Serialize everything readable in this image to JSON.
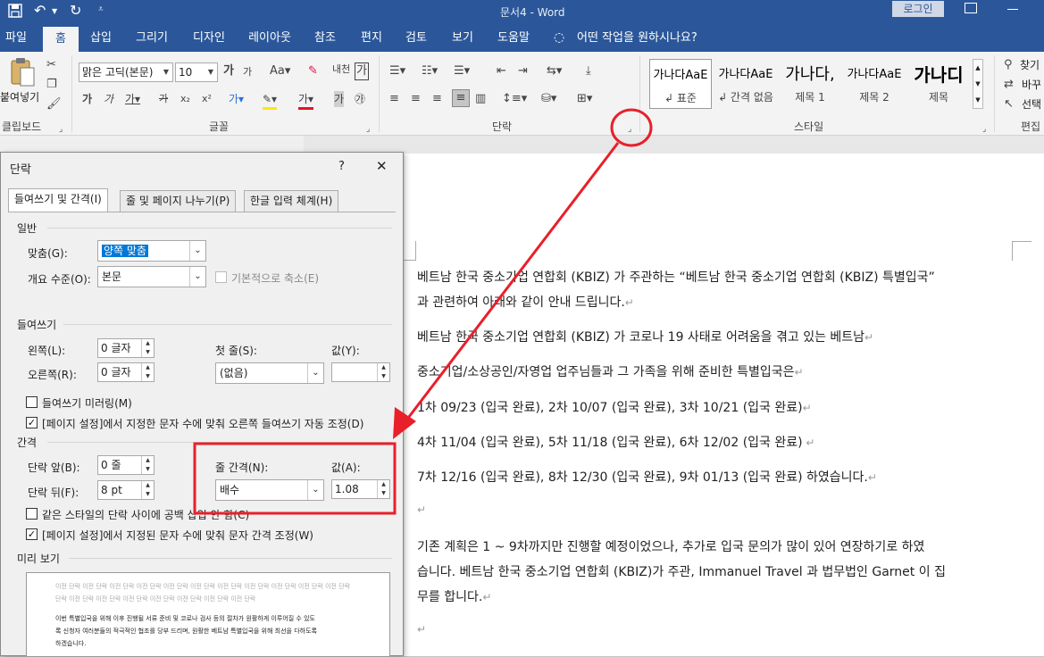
{
  "titlebar": {
    "title": "문서4 - Word",
    "login": "로그인"
  },
  "tabs": [
    "파일",
    "홈",
    "삽입",
    "그리기",
    "디자인",
    "레이아웃",
    "참조",
    "편지",
    "검토",
    "보기",
    "도움말"
  ],
  "tellme": "어떤 작업을 원하시나요?",
  "ribbon": {
    "paste": "붙여넣기",
    "clipboard": "클립보드",
    "font_group": "글꼴",
    "paragraph_group": "단락",
    "styles_group": "스타일",
    "edit_group": "편집",
    "font_name": "맑은 고딕(본문)",
    "font_size": "10",
    "styles": [
      {
        "sample": "가나다AaE",
        "name": "↲ 표준"
      },
      {
        "sample": "가나다AaE",
        "name": "↲ 간격 없음"
      },
      {
        "sample": "가나다,",
        "name": "제목 1"
      },
      {
        "sample": "가나다AaE",
        "name": "제목 2"
      },
      {
        "sample": "가나디",
        "name": "제목"
      }
    ],
    "find": "찾기",
    "replace": "바꾸",
    "select": "선택"
  },
  "dialog": {
    "title": "단락",
    "help": "?",
    "close": "✕",
    "tabs": [
      "들여쓰기 및 간격(I)",
      "줄 및 페이지 나누기(P)",
      "한글 입력 체계(H)"
    ],
    "general": "일반",
    "alignment_label": "맞춤(G):",
    "alignment_value": "양쪽 맞춤",
    "outline_label": "개요 수준(O):",
    "outline_value": "본문",
    "collapsed_label": "기본적으로 축소(E)",
    "indent": "들여쓰기",
    "left_label": "왼쪽(L):",
    "left_value": "0 글자",
    "right_label": "오른쪽(R):",
    "right_value": "0 글자",
    "first_line_label": "첫 줄(S):",
    "first_line_value": "(없음)",
    "by_label": "값(Y):",
    "by_value": "",
    "mirror_label": "들여쓰기 미러링(M)",
    "auto_indent_label": "[페이지 설정]에서 지정한 문자 수에 맞춰 오른쪽 들여쓰기 자동 조정(D)",
    "spacing": "간격",
    "before_label": "단락 앞(B):",
    "before_value": "0 줄",
    "after_label": "단락 뒤(F):",
    "after_value": "8 pt",
    "line_spacing_label": "줄 간격(N):",
    "line_spacing_value": "배수",
    "at_label": "값(A):",
    "at_value": "1.08",
    "no_space_label": "같은 스타일의 단락 사이에 공백 삽입 안 함(C)",
    "grid_label": "[페이지 설정]에서 지정된 문자 수에 맞춰 문자 간격 조정(W)",
    "preview": "미리 보기",
    "preview_prev1": "이전 단락 이전 단락 이전 단락 이전 단락 이전 단락 이전 단락 이전 단락 이전 단락 이전 단락 이전 단락 이전 단락",
    "preview_prev2": "단락 이전 단락 이전 단락 이전 단락 이전 단락 이전 단락 이전 단락 이전 단락",
    "preview_cur1": "이번 특별입국을 위해 이후 진행될 서류 준비 및 코로나 검사 등의 절차가 원활하게 이루어질 수 있도",
    "preview_cur2": "록 신청자 여러분들의 적극적인 협조를 당부 드리며, 원활한 베트남 특별입국을 위해 최선을 다하도록",
    "preview_cur3": "하겠습니다."
  },
  "document": {
    "lines": [
      "베트남 한국 중소기업 연합회 (KBIZ) 가 주관하는 “베트남 한국 중소기업 연합회 (KBIZ) 특별입국”",
      "과 관련하여 아래와 같이 안내 드립니다.",
      "베트남 한국 중소기업 연합회 (KBIZ) 가 코로나 19 사태로 어려움을 겪고 있는 베트남",
      "중소기업/소상공인/자영업 업주님들과 그 가족을 위해 준비한 특별입국은",
      "1차 09/23 (입국 완료), 2차 10/07 (입국 완료), 3차 10/21 (입국 완료)",
      "4차 11/04 (입국 완료), 5차 11/18 (입국 완료), 6차 12/02 (입국 완료)",
      "7차 12/16 (입국 완료), 8차 12/30 (입국 완료), 9차 01/13 (입국 완료) 하였습니다.",
      "",
      "기존 계획은 1 ~ 9차까지만 진행할 예정이었으나, 추가로 입국 문의가 많이 있어 연장하기로 하였",
      "습니다. 베트남 한국 중소기업 연합회 (KBIZ)가 주관, Immanuel Travel 과 법무법인 Garnet 이 집",
      "무를 합니다.",
      ""
    ]
  },
  "colors": {
    "word_blue": "#2b579a",
    "annotation_red": "#e8202a",
    "selection": "#0078d7"
  }
}
